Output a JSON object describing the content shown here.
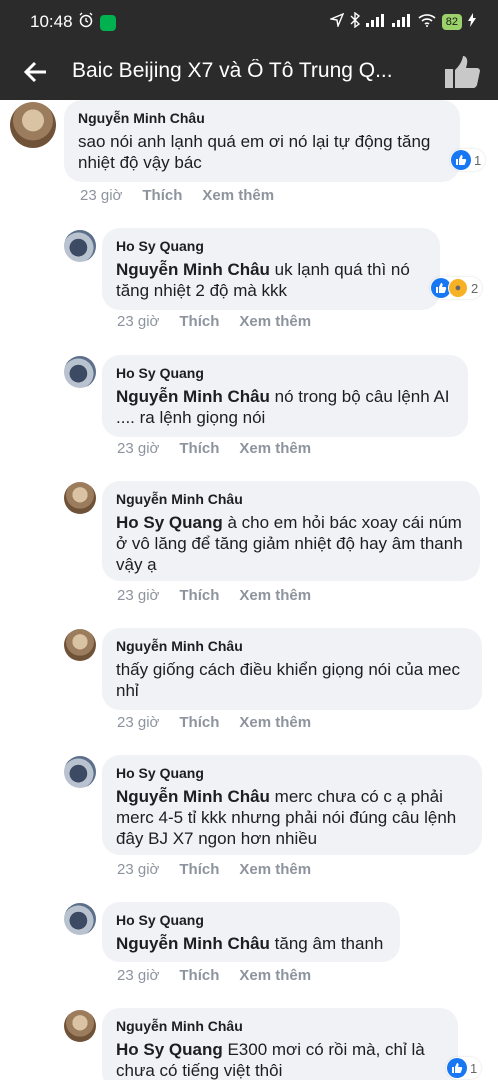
{
  "status_bar": {
    "time": "10:48",
    "battery": "82",
    "icons": [
      "alarm-icon",
      "grab-app-icon",
      "location-icon",
      "bluetooth-icon",
      "signal-icon",
      "signal-icon",
      "wifi-icon",
      "battery-icon",
      "charging-icon"
    ]
  },
  "app_bar": {
    "title": "Baic Beijing X7 và Ô Tô Trung Q...",
    "icons": [
      "back-arrow-icon",
      "thumbs-up-icon"
    ]
  },
  "comments": [
    {
      "author": "Nguyễn Minh Châu",
      "mention": "",
      "text": "sao nói anh lạnh quá em ơi nó lại tự động tăng nhiệt độ vậy bác",
      "time": "23 giờ",
      "like_label": "Thích",
      "more_label": "Xem thêm",
      "reaction_count": "1"
    },
    {
      "author": "Ho Sy Quang",
      "mention": "Nguyễn Minh Châu",
      "text": " uk lạnh quá thì nó tăng nhiệt 2 độ mà kkk",
      "time": "23 giờ",
      "like_label": "Thích",
      "more_label": "Xem thêm",
      "reaction_count": "2"
    },
    {
      "author": "Ho Sy Quang",
      "mention": "Nguyễn Minh Châu",
      "text": " nó trong bộ câu lệnh AI .... ra lệnh giọng nói",
      "time": "23 giờ",
      "like_label": "Thích",
      "more_label": "Xem thêm"
    },
    {
      "author": "Nguyễn Minh Châu",
      "mention": "Ho Sy Quang",
      "text": " à cho em hỏi bác xoay cái núm ở vô lăng để tăng giảm nhiệt độ hay âm thanh vậy ạ",
      "time": "23 giờ",
      "like_label": "Thích",
      "more_label": "Xem thêm"
    },
    {
      "author": "Nguyễn Minh Châu",
      "mention": "",
      "text": "thấy giống cách điều khiển giọng nói của mec nhỉ",
      "time": "23 giờ",
      "like_label": "Thích",
      "more_label": "Xem thêm"
    },
    {
      "author": "Ho Sy Quang",
      "mention": "Nguyễn Minh Châu",
      "text": " merc chưa có c ạ phải merc 4-5 tỉ kkk nhưng phải nói đúng câu lệnh đây BJ X7 ngon hơn nhiều",
      "time": "23 giờ",
      "like_label": "Thích",
      "more_label": "Xem thêm"
    },
    {
      "author": "Ho Sy Quang",
      "mention": "Nguyễn Minh Châu",
      "text": " tăng âm thanh",
      "time": "23 giờ",
      "like_label": "Thích",
      "more_label": "Xem thêm"
    },
    {
      "author": "Nguyễn Minh Châu",
      "mention": "Ho Sy Quang",
      "text": " E300 mơi có rồi mà, chỉ là chưa có tiếng việt thôi",
      "reaction_count": "1"
    }
  ]
}
